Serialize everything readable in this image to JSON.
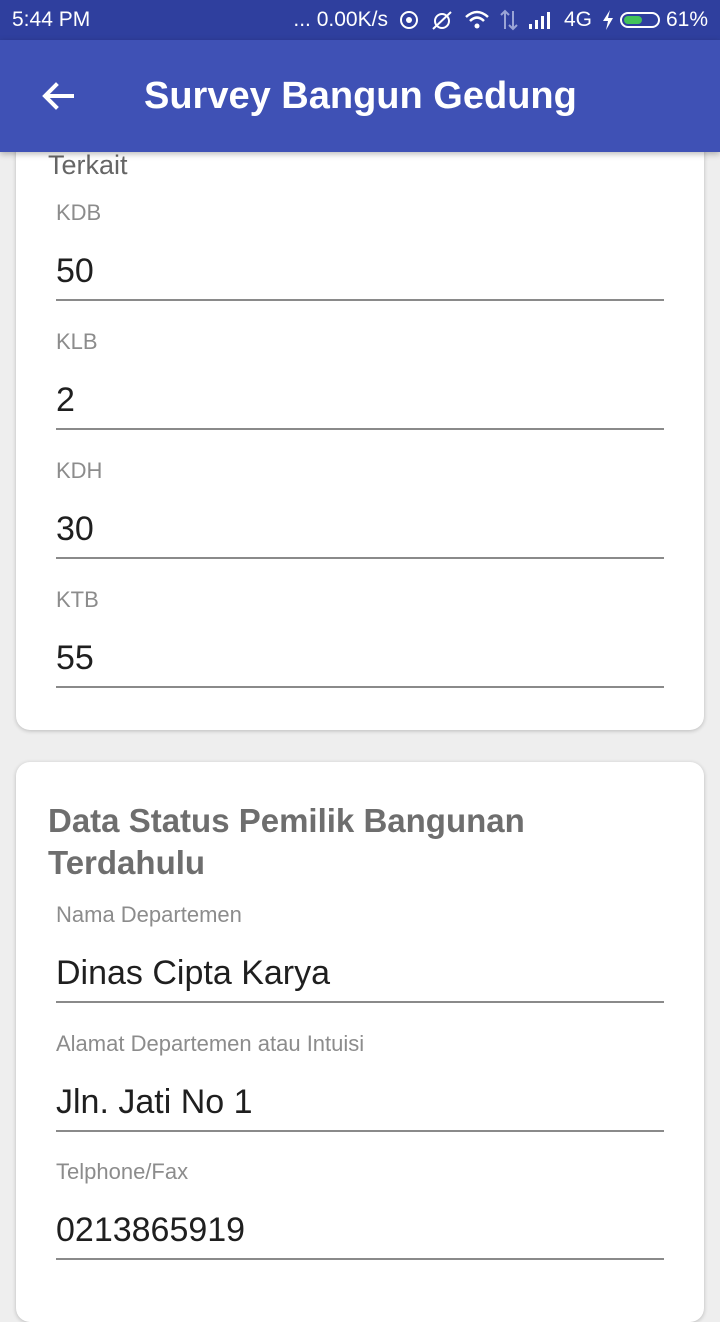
{
  "status_bar": {
    "time": "5:44 PM",
    "speed": "... 0.00K/s",
    "network": "4G",
    "battery": "61%",
    "battery_level": 0.61,
    "icons": [
      "hotspot-icon",
      "alarm-off-icon",
      "wifi-icon",
      "data-transfer-icon",
      "signal-icon",
      "charging-icon",
      "battery-icon"
    ]
  },
  "app_bar": {
    "title": "Survey Bangun Gedung",
    "back_icon": "arrow-back-icon",
    "color": "#3f51b5"
  },
  "section1": {
    "title_tail": "Terkait",
    "fields": [
      {
        "label": "KDB",
        "value": "50"
      },
      {
        "label": "KLB",
        "value": "2"
      },
      {
        "label": "KDH",
        "value": "30"
      },
      {
        "label": "KTB",
        "value": "55"
      }
    ]
  },
  "section2": {
    "title": "Data Status Pemilik Bangunan Terdahulu",
    "fields": [
      {
        "label": "Nama Departemen",
        "value": "Dinas Cipta Karya"
      },
      {
        "label": "Alamat Departemen atau Intuisi",
        "value": "Jln. Jati No 1"
      },
      {
        "label": "Telphone/Fax",
        "value": "0213865919"
      }
    ]
  }
}
